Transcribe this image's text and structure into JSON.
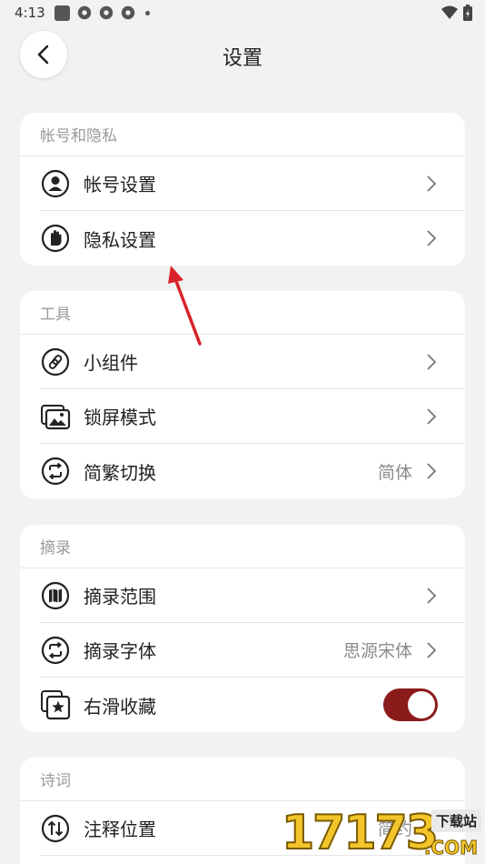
{
  "status": {
    "time": "4:13"
  },
  "header": {
    "title": "设置"
  },
  "sections": [
    {
      "title": "帐号和隐私",
      "items": [
        {
          "label": "帐号设置",
          "value": ""
        },
        {
          "label": "隐私设置",
          "value": ""
        }
      ]
    },
    {
      "title": "工具",
      "items": [
        {
          "label": "小组件",
          "value": ""
        },
        {
          "label": "锁屏模式",
          "value": ""
        },
        {
          "label": "简繁切换",
          "value": "简体"
        }
      ]
    },
    {
      "title": "摘录",
      "items": [
        {
          "label": "摘录范围",
          "value": ""
        },
        {
          "label": "摘录字体",
          "value": "思源宋体"
        },
        {
          "label": "右滑收藏",
          "toggle_on": true
        }
      ]
    },
    {
      "title": "诗词",
      "items": [
        {
          "label": "注释位置",
          "value": "简约"
        }
      ]
    }
  ],
  "colors": {
    "accent": "#8b1a1a",
    "background": "#f2f2f2",
    "annotation_arrow": "#d9232a"
  },
  "watermark": {
    "number": "17173",
    "tag": "下载站",
    "suffix": ".COM"
  }
}
